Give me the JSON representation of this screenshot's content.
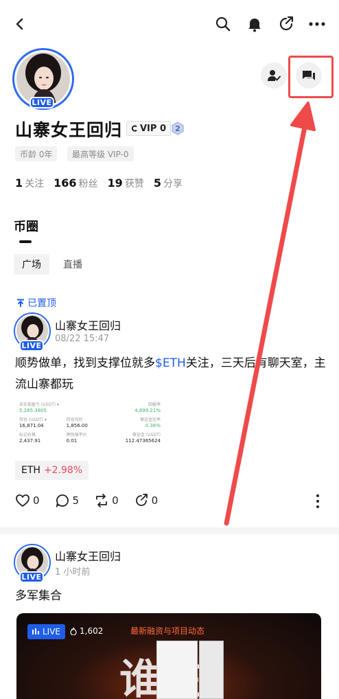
{
  "profile": {
    "name": "山寨女王回归",
    "vip_label": "VIP 0",
    "level": "2",
    "live_label": "LIVE",
    "chips": [
      "币龄 0年",
      "最高等级 VIP-0"
    ]
  },
  "stats": [
    {
      "num": "1",
      "label": "关注"
    },
    {
      "num": "166",
      "label": "粉丝"
    },
    {
      "num": "19",
      "label": "获赞"
    },
    {
      "num": "5",
      "label": "分享"
    }
  ],
  "section": {
    "title": "币圈"
  },
  "subtabs": [
    {
      "label": "广场",
      "active": true
    },
    {
      "label": "直播",
      "active": false
    }
  ],
  "post1": {
    "pinned_label": "已置顶",
    "author": "山寨女王回归",
    "time": "08/22 15:47",
    "live_label": "LIVE",
    "text_before": "顺势做单，找到支撑位就多",
    "text_link": "$ETH",
    "text_after": "关注，三天后有聊天室，主流山寨都玩",
    "trade": {
      "cells": [
        {
          "label": "未实现盈亏 (USDT) ▾",
          "value": "5,285.3805",
          "green": true,
          "align": "left"
        },
        {
          "label": "",
          "value": "",
          "green": false,
          "align": "left"
        },
        {
          "label": "回报率",
          "value": "4,699.21%",
          "green": true,
          "align": "right"
        },
        {
          "label": "持仓 (USDT) ▾",
          "value": "16,871.04",
          "green": false,
          "align": "left"
        },
        {
          "label": "持仓均价",
          "value": "1,856.00",
          "green": false,
          "align": "left"
        },
        {
          "label": "保证金比率",
          "value": "0.36%",
          "green": true,
          "align": "right"
        },
        {
          "label": "标记价格",
          "value": "2,437.91",
          "green": false,
          "align": "left"
        },
        {
          "label": "预估强平价",
          "value": "0.01",
          "green": false,
          "align": "left"
        },
        {
          "label": "保证金 (USDT)",
          "value": "112.47365624",
          "green": false,
          "align": "right"
        }
      ]
    },
    "coin": "ETH",
    "change": "+2.98%",
    "likes": "0",
    "comments": "5",
    "reposts": "0",
    "shares": "0"
  },
  "post2": {
    "author": "山寨女王回归",
    "time": "1 小时前",
    "live_label": "LIVE",
    "text": "多军集合",
    "video": {
      "live_tag": "LIVE",
      "viewers": "1,602",
      "title": "最新融资与项目动态",
      "overlay_text": "谁在"
    }
  },
  "colors": {
    "accent": "#1f5de8",
    "highlight": "#ef4a4a",
    "positive": "#3bb56a",
    "negative": "#e84a5f"
  }
}
